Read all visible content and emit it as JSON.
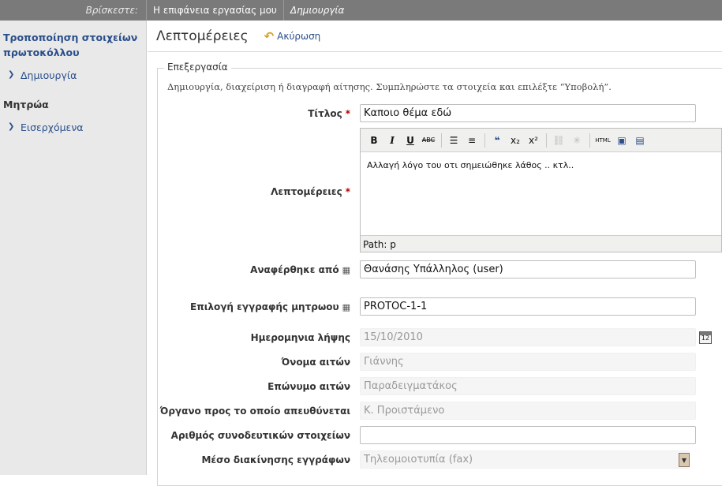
{
  "breadcrumb": {
    "label": "Βρίσκεστε:",
    "items": [
      "Η επιφάνεια εργασίας μου",
      "Δημιουργία"
    ]
  },
  "sidebar": {
    "title": "Τροποποίηση στοιχείων πρωτοκόλλου",
    "create": "Δημιουργία",
    "section": "Μητρώα",
    "inbox": "Εισερχόμενα"
  },
  "header": {
    "title": "Λεπτομέρειες",
    "cancel": "Ακύρωση"
  },
  "form": {
    "legend": "Επεξεργασία",
    "help": "Δημιουργία, διαχείριση ή διαγραφή αίτησης. Συμπληρώστε τα στοιχεία και επιλέξτε “Υποβολή”.",
    "title_label": "Τίτλος",
    "title_value": "Καποιο θέμα εδώ",
    "details_label": "Λεπτομέρειες",
    "details_value": "Αλλαγή λόγο του οτι σημειώθηκε λάθος .. κτλ..",
    "editor_path": "Path:  p",
    "reported_label": "Αναφέρθηκε από",
    "reported_value": "Θανάσης Υπάλληλος (user)",
    "registry_label": "Επιλογή εγγραφής μητρωου",
    "registry_value": "PROTOC-1-1",
    "date_label": "Ημερομηνια λήψης",
    "date_value": "15/10/2010",
    "name_label": "Όνομα αιτών",
    "name_value": "Γιάννης",
    "surname_label": "Επώνυμο αιτών",
    "surname_value": "Παραδειγματάκος",
    "organ_label": "Όργανο προς το οποίο απευθύνεται",
    "organ_value": "Κ. Προιστάμενο",
    "attachments_label": "Αριθμός συνοδευτικών στοιχείων",
    "attachments_value": "",
    "medium_label": "Μέσο διακίνησης εγγράφων",
    "medium_value": "Τηλεομοιοτυπία (fax)"
  },
  "toolbar_labels": {
    "bold": "B",
    "italic": "I",
    "underline": "U",
    "strike": "ABC",
    "subscript": "x₂",
    "superscript": "x²",
    "html": "HTML"
  },
  "colors": {
    "link": "#2a4f8a",
    "required": "#b30000",
    "topbar": "#7a7a7a"
  }
}
